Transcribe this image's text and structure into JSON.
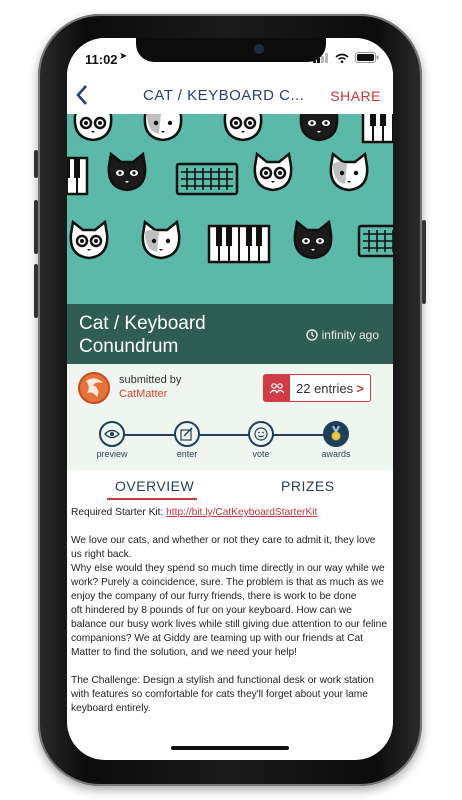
{
  "status_bar": {
    "time": "11:02"
  },
  "nav": {
    "back_icon": "chevron-left-icon",
    "title": "CAT / KEYBOARD C...",
    "share_label": "SHARE"
  },
  "challenge": {
    "title": "Cat / Keyboard Conundrum",
    "time_ago": "infinity ago",
    "submitted_by_label": "submitted by",
    "submitter": "CatMatter",
    "entries_label": "22 entries"
  },
  "steps": [
    {
      "label": "preview",
      "icon": "eye-icon"
    },
    {
      "label": "enter",
      "icon": "edit-icon"
    },
    {
      "label": "vote",
      "icon": "smiley-icon"
    },
    {
      "label": "awards",
      "icon": "medal-icon"
    }
  ],
  "tabs": {
    "overview": "OVERVIEW",
    "prizes": "PRIZES"
  },
  "body": {
    "starter_label": "Required Starter Kit:",
    "starter_link": "http://bit.ly/CatKeyboardStarterKit",
    "para1": "We love our cats, and whether or not they care to admit it, they love us right back.",
    "para2": "Why else would they spend so much time directly in our way while we work? Purely a coincidence, sure. The problem is that as much as we enjoy the company of our furry friends, there is work to be done",
    "para3": "oft hindered by 8 pounds of fur on your keyboard. How can we balance our busy work lives while still giving due attention to our feline companions? We at Giddy are teaming up with our friends at Cat Matter to find the solution, and we need your help!",
    "para4": "The Challenge: Design a stylish and functional desk or work station with features so comfortable for cats they'll forget about your lame keyboard entirely."
  },
  "colors": {
    "accent": "#c8343f",
    "navy": "#2a3e7a",
    "hero_bg": "#5ab9a7",
    "title_bg": "#2f5c53"
  }
}
